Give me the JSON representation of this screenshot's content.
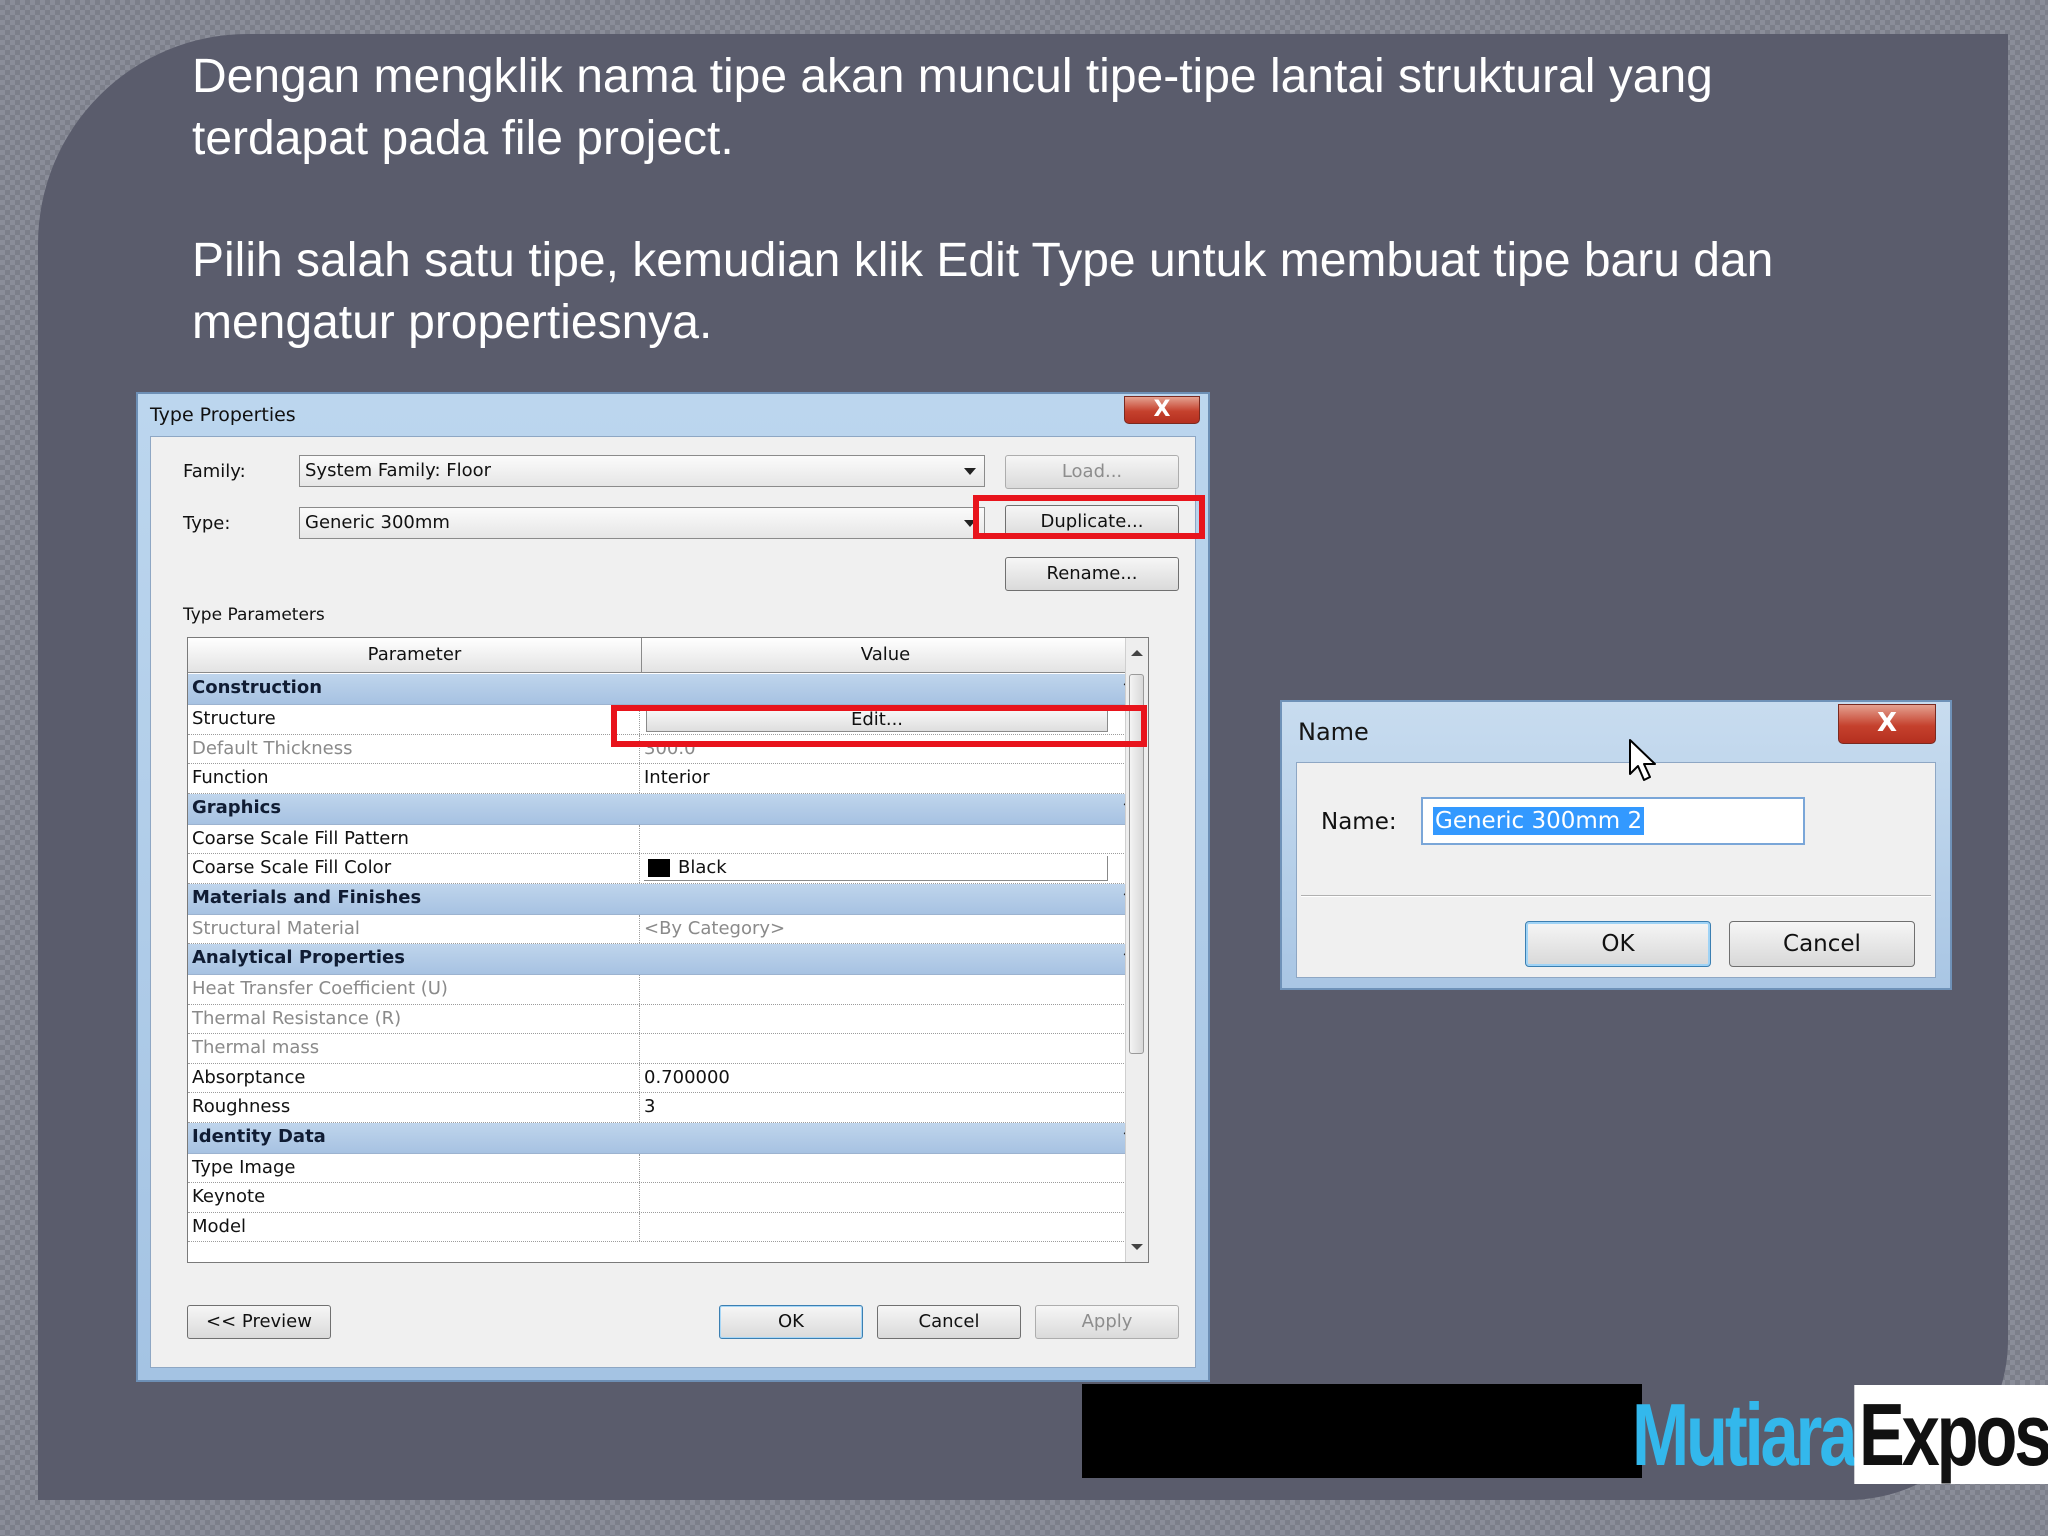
{
  "slide": {
    "caption1": "Dengan mengklik nama tipe akan muncul tipe-tipe lantai struktural yang terdapat pada file project.",
    "caption2": "Pilih salah satu tipe, kemudian klik Edit Type untuk membuat tipe baru dan mengatur propertiesnya.",
    "logo_part1": "Mutiara",
    "logo_part2": "Expose",
    "highlight_color": "#e8141c"
  },
  "type_properties": {
    "title": "Type Properties",
    "close_label": "X",
    "family_label": "Family:",
    "family_value": "System Family: Floor",
    "type_label": "Type:",
    "type_value": "Generic 300mm",
    "load_label": "Load...",
    "duplicate_label": "Duplicate...",
    "rename_label": "Rename...",
    "type_parameters_label": "Type Parameters",
    "col_parameter": "Parameter",
    "col_value": "Value",
    "col_eq": "=",
    "groups": {
      "construction": "Construction",
      "graphics": "Graphics",
      "materials": "Materials and Finishes",
      "analytical": "Analytical Properties",
      "identity": "Identity Data"
    },
    "rows": {
      "structure": {
        "p": "Structure",
        "v": "Edit..."
      },
      "default_thickness": {
        "p": "Default Thickness",
        "v": "300.0"
      },
      "function": {
        "p": "Function",
        "v": "Interior"
      },
      "coarse_pattern": {
        "p": "Coarse Scale Fill Pattern",
        "v": ""
      },
      "coarse_color": {
        "p": "Coarse Scale Fill Color",
        "v": "Black"
      },
      "structural_material": {
        "p": "Structural Material",
        "v": "<By Category>"
      },
      "heat_transfer": {
        "p": "Heat Transfer Coefficient (U)",
        "v": ""
      },
      "thermal_resistance": {
        "p": "Thermal Resistance (R)",
        "v": ""
      },
      "thermal_mass": {
        "p": "Thermal mass",
        "v": ""
      },
      "absorptance": {
        "p": "Absorptance",
        "v": "0.700000"
      },
      "roughness": {
        "p": "Roughness",
        "v": "3"
      },
      "type_image": {
        "p": "Type Image",
        "v": ""
      },
      "keynote": {
        "p": "Keynote",
        "v": ""
      },
      "model": {
        "p": "Model",
        "v": ""
      }
    },
    "preview_label": "<< Preview",
    "ok_label": "OK",
    "cancel_label": "Cancel",
    "apply_label": "Apply"
  },
  "name_dialog": {
    "title": "Name",
    "close_label": "X",
    "name_label": "Name:",
    "name_value": "Generic 300mm 2",
    "ok_label": "OK",
    "cancel_label": "Cancel"
  }
}
